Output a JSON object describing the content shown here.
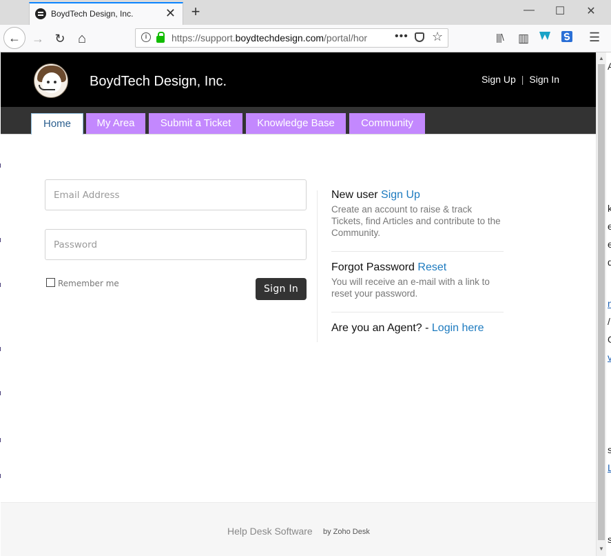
{
  "browser": {
    "tab_title": "BoydTech Design, Inc.",
    "tab_close": "✕",
    "new_tab": "+",
    "minimize": "—",
    "maximize": "☐",
    "close": "✕",
    "url_prefix": "https://support.",
    "url_domain": "boydtechdesign.com",
    "url_suffix": "/portal/hor",
    "more_label": "•••",
    "bookmark_icon": "star-icon",
    "back_glyph": "←",
    "forward_glyph": "→",
    "reload_glyph": "↻",
    "home_glyph": "⌂",
    "menu_glyph": "☰",
    "library_glyph": "|||\\",
    "sidebar_glyph": "▥"
  },
  "site": {
    "brand": "BoydTech Design, Inc.",
    "header_links": {
      "signup": "Sign Up",
      "separator": "|",
      "signin": "Sign In"
    },
    "nav_tabs": [
      "Home",
      "My Area",
      "Submit a Ticket",
      "Knowledge Base",
      "Community"
    ],
    "active_tab": "Home",
    "login": {
      "email_placeholder": "Email Address",
      "password_placeholder": "Password",
      "remember_label": "Remember me",
      "signin_button": "Sign In"
    },
    "info": {
      "new_user_prefix": "New user",
      "new_user_link": "Sign Up",
      "new_user_text": "Create an account to raise & track Tickets, find Articles and contribute to the Community.",
      "forgot_prefix": "Forgot Password",
      "forgot_link": "Reset",
      "forgot_text": "You will receive an e-mail with a link to reset your password.",
      "agent_prefix": "Are you an Agent? -",
      "agent_link": "Login here"
    },
    "footer": {
      "product": "Help Desk Software",
      "by": "by Zoho Desk"
    },
    "colors": {
      "header_bg": "#000000",
      "tab_bg": "#c388fe",
      "link": "#1c7abf",
      "button": "#333333"
    }
  }
}
